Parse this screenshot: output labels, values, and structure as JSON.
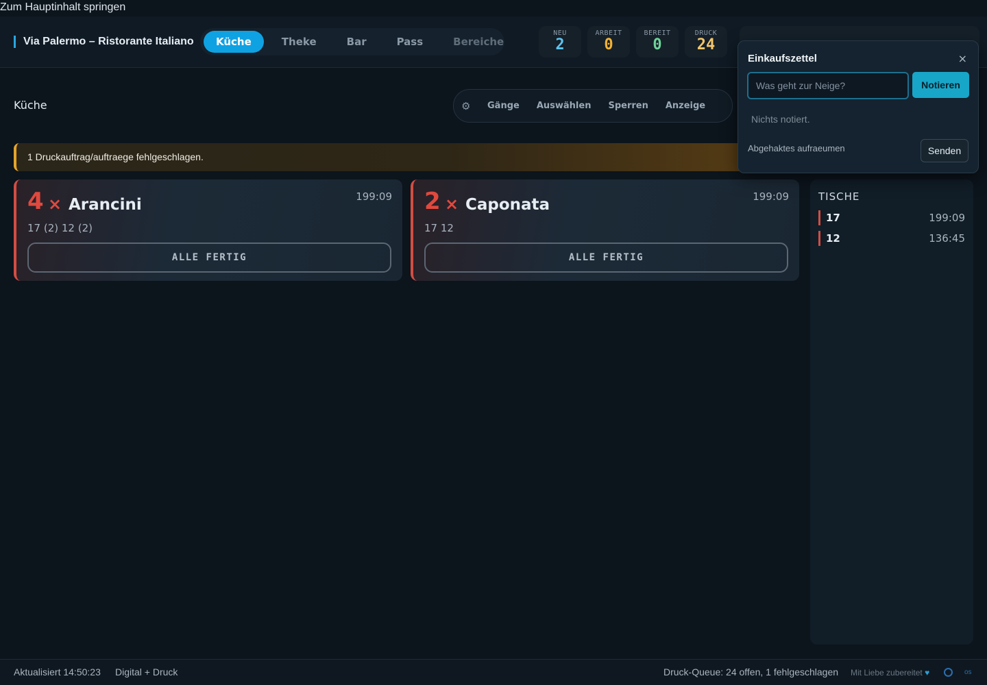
{
  "skip_link": "Zum Hauptinhalt springen",
  "header": {
    "brand": "Via Palermo – Ristorante Italiano",
    "stations": [
      {
        "label": "Küche",
        "active": true
      },
      {
        "label": "Theke",
        "active": false
      },
      {
        "label": "Bar",
        "active": false
      },
      {
        "label": "Pass",
        "active": false
      },
      {
        "label": "Bereiche",
        "active": false
      }
    ],
    "stats": [
      {
        "label": "NEU",
        "value": "2",
        "color": "#5cc4ee"
      },
      {
        "label": "ARBEIT",
        "value": "0",
        "color": "#f2b233"
      },
      {
        "label": "BEREIT",
        "value": "0",
        "color": "#6fd39a"
      },
      {
        "label": "DRUCK",
        "value": "24",
        "color": "#f4c66b"
      }
    ]
  },
  "page": {
    "title": "Küche",
    "toolbar": [
      "Gänge",
      "Auswählen",
      "Sperren",
      "Anzeige"
    ],
    "toolbar_icon": "gear-icon"
  },
  "alert": {
    "text": "1 Druckauftrag/auftraege fehlgeschlagen.",
    "color": "#e4a52a"
  },
  "cards": [
    {
      "qty": "4",
      "name": "Arancini",
      "time": "199:09",
      "tables": "17 (2)  12 (2)",
      "button": "ALLE FERTIG"
    },
    {
      "qty": "2",
      "name": "Caponata",
      "time": "199:09",
      "tables": "17  12",
      "button": "ALLE FERTIG"
    }
  ],
  "tables_panel": {
    "title": "TISCHE",
    "rows": [
      {
        "number": "17",
        "time": "199:09"
      },
      {
        "number": "12",
        "time": "136:45"
      }
    ]
  },
  "footer": {
    "updated": "Aktualisiert 14:50:23",
    "mode": "Digital + Druck",
    "queue": "Druck-Queue: 24 offen, 1 fehlgeschlagen",
    "love": "Mit Liebe zubereitet",
    "os_label": "os"
  },
  "shopping_list": {
    "title": "Einkaufszettel",
    "close": "×",
    "placeholder": "Was geht zur Neige?",
    "add_button": "Notieren",
    "empty": "Nichts notiert.",
    "clear_checked": "Abgehaktes aufraeumen",
    "send_button": "Senden"
  }
}
